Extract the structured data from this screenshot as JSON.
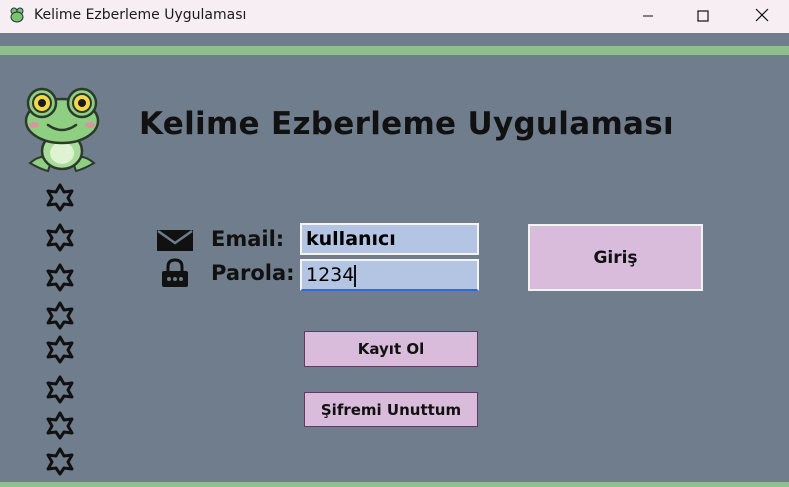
{
  "window": {
    "title": "Kelime Ezberleme Uygulaması",
    "app_icon": "frog-icon",
    "controls": [
      "minimize-icon",
      "maximize-icon",
      "close-icon"
    ]
  },
  "main": {
    "heading": "Kelime Ezberleme Uygulaması",
    "decoration": {
      "mascot": "frog-mascot",
      "side_icons": "flower-outline-icon",
      "side_icon_count": 8
    },
    "form": {
      "email_label": "Email:",
      "email_value": "kullanıcı",
      "email_icon": "envelope-icon",
      "password_label": "Parola:",
      "password_value": "1234",
      "password_icon": "lock-icon"
    },
    "buttons": {
      "login": "Giriş",
      "register": "Kayıt Ol",
      "forgot": "Şifremi Unuttum"
    }
  },
  "colors": {
    "background": "#6f7d8c",
    "accent_green": "#8fbf8c",
    "button": "#d9bcdc",
    "input": "#b3c5e3"
  }
}
